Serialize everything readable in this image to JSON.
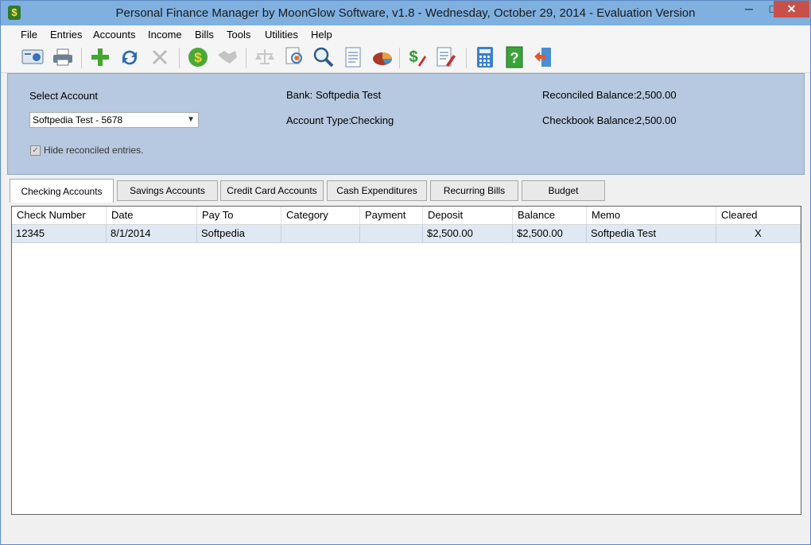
{
  "window": {
    "title": "Personal Finance Manager by MoonGlow Software, v1.8  -  Wednesday, October 29, 2014  -  Evaluation Version",
    "min": "─",
    "max": "□",
    "close": "✕"
  },
  "menu": [
    "File",
    "Entries",
    "Accounts",
    "Income",
    "Bills",
    "Tools",
    "Utilities",
    "Help"
  ],
  "toolbar": {
    "icons": [
      "account-view-icon",
      "print-icon",
      "add-icon",
      "refresh-icon",
      "delete-icon",
      "money-icon",
      "handshake-icon",
      "scale-icon",
      "search-doc-icon",
      "magnify-icon",
      "document-icon",
      "pie-chart-icon",
      "edit-money-icon",
      "edit-doc-icon",
      "calculator-icon",
      "help-icon",
      "exit-icon"
    ]
  },
  "account_panel": {
    "select_label": "Select Account",
    "selected_account": "Softpedia Test - 5678",
    "hide_reconciled": "Hide reconciled entries.",
    "bank_label": "Bank:",
    "bank_value": "Softpedia Test",
    "type_label": "Account Type:",
    "type_value": "Checking",
    "reconciled_label": "Reconciled Balance:",
    "reconciled_value": "2,500.00",
    "checkbook_label": "Checkbook Balance:",
    "checkbook_value": "2,500.00"
  },
  "tabs": [
    "Checking Accounts",
    "Savings Accounts",
    "Credit Card Accounts",
    "Cash Expenditures",
    "Recurring Bills",
    "Budget"
  ],
  "table": {
    "headers": [
      "Check Number",
      "Date",
      "Pay To",
      "Category",
      "Payment",
      "Deposit",
      "Balance",
      "Memo",
      "Cleared"
    ],
    "rows": [
      [
        "12345",
        "8/1/2014",
        "Softpedia",
        "",
        "",
        "$2,500.00",
        "$2,500.00",
        "Softpedia Test",
        "X"
      ]
    ]
  },
  "colors": {
    "titlebar": "#7fb0e0",
    "panel": "#b7c9e0",
    "row_selected": "#dfe8f3",
    "close_button": "#c7514a"
  }
}
